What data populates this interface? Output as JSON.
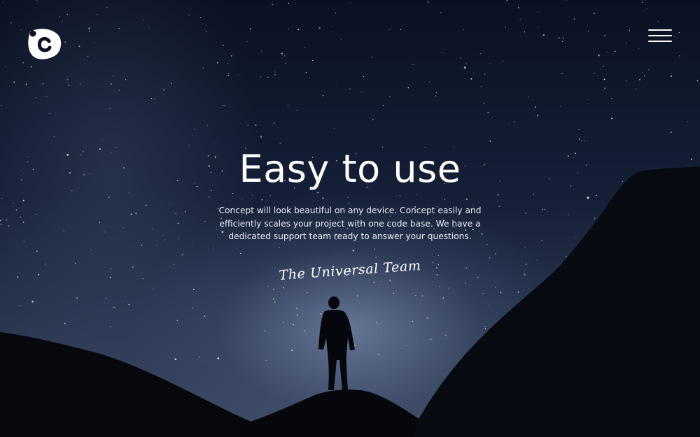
{
  "header": {
    "logo_icon": "concept-c-logo",
    "menu_icon": "hamburger-menu-icon"
  },
  "hero": {
    "headline": "Easy to use",
    "description": "Concept will look beautiful on any device. Concept easily and efficiently scales your project with one code base. We have a dedicated support team ready to answer your questions.",
    "signature": "The Universal Team",
    "background": "night-sky-mountains-silhouette-person"
  },
  "colors": {
    "text": "#ffffff",
    "sky_top": "#0b1122",
    "sky_horizon": "#3e4a63",
    "silhouette": "#07090f"
  }
}
